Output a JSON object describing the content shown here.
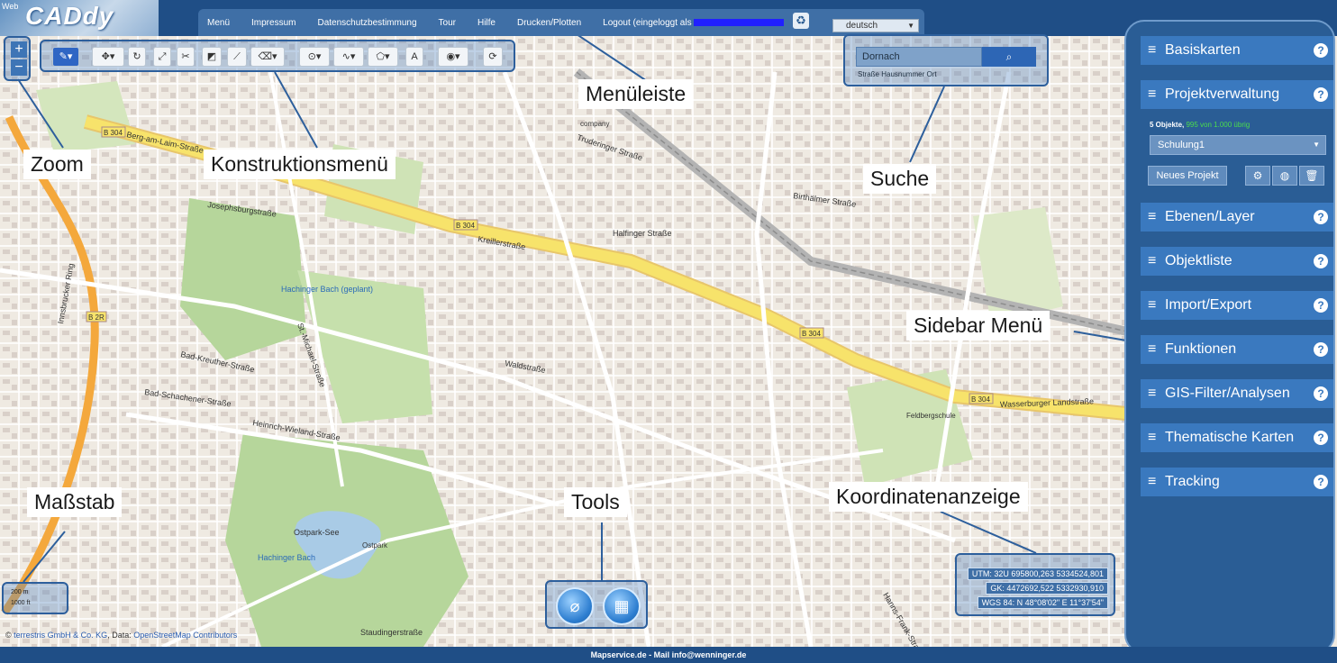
{
  "app": {
    "logo": "CADdy",
    "logo_prefix": "Web"
  },
  "menu": {
    "items": [
      "Menü",
      "Impressum",
      "Datenschutzbestimmung",
      "Tour",
      "Hilfe",
      "Drucken/Plotten"
    ],
    "logout_prefix": "Logout (eingeloggt als",
    "language": "deutsch"
  },
  "search": {
    "value": "Dornach",
    "button_icon": "search-icon",
    "hint": "Straße Hausnummer Ort"
  },
  "map": {
    "roads": [
      "Berg-am-Laim-Straße",
      "Kreillerstraße",
      "Wasserburger Landstraße",
      "Heinrich-Wieland-Straße",
      "Innsbrucker Ring",
      "Truderinger Straße",
      "Birthälmer Straße",
      "Halfinger Straße",
      "Bad-Schachener-Straße",
      "Bad-Kreuther-Straße",
      "Waldstraße",
      "Hanns-Frank-Straße",
      "Staudingerstraße",
      "St.-Michael-Straße",
      "Josephsburgstraße"
    ],
    "road_badges": [
      "B 304",
      "B 2R"
    ],
    "places": [
      "Hachinger Bach (geplant)",
      "Hachinger Bach",
      "Ostpark-See",
      "Ostpark",
      "Feldbergschule",
      "company"
    ]
  },
  "annotations": {
    "zoom": "Zoom",
    "construction": "Konstruktionsmenü",
    "menubar": "Menüleiste",
    "search": "Suche",
    "sidebar": "Sidebar Menü",
    "scale": "Maßstab",
    "tools": "Tools",
    "coords": "Koordinatenanzeige"
  },
  "scale": {
    "top": "200 m",
    "bottom": "1000 ft"
  },
  "coordinates": {
    "utm": "UTM: 32U 695800,263 5334524,801",
    "gk": "GK: 4472692,522 5332930,910",
    "wgs": "WGS 84: N 48°08'02\" E 11°37'54\""
  },
  "sidebar": {
    "sections": [
      "Basiskarten",
      "Projektverwaltung",
      "Ebenen/Layer",
      "Objektliste",
      "Import/Export",
      "Funktionen",
      "GIS-Filter/Analysen",
      "Thematische Karten",
      "Tracking"
    ],
    "projects_count": "5 Objekte,",
    "projects_free": "995 von 1.000 übrig",
    "project_selected": "Schulung1",
    "new_project": "Neues Projekt"
  },
  "attribution": {
    "prefix": "©",
    "company": "terrestris GmbH & Co. KG",
    "data": ", Data:",
    "source": "OpenStreetMap Contributors"
  },
  "footer": "Mapservice.de - Mail info@wenninger.de",
  "colors": {
    "header": "#1f4e86",
    "accent": "#3a79bf",
    "highway": "#f7e36b",
    "park": "#b6d69b"
  }
}
